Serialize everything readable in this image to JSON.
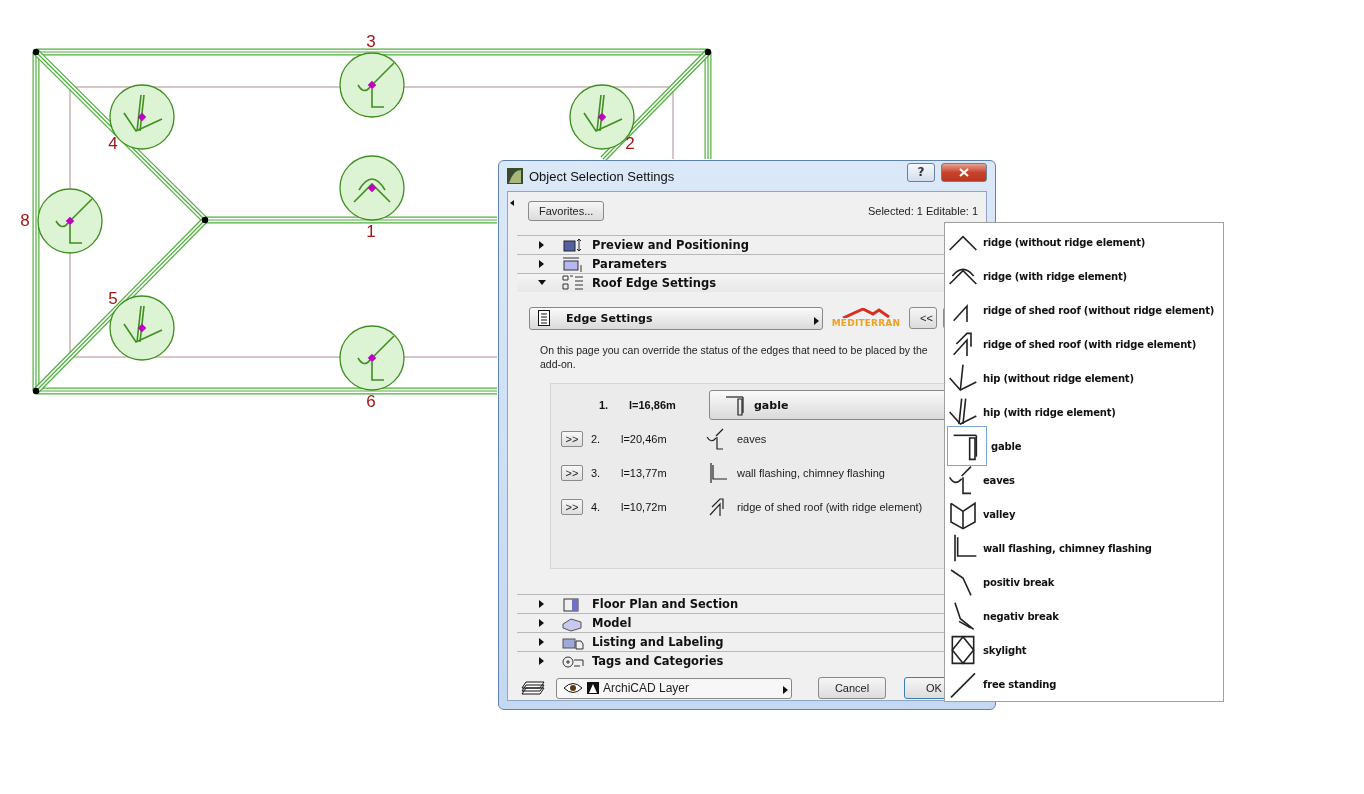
{
  "canvas": {
    "markers": [
      {
        "label": "3",
        "kind": "eaves"
      },
      {
        "label": "4",
        "kind": "hip"
      },
      {
        "label": "2",
        "kind": "hip"
      },
      {
        "label": "8",
        "kind": "eaves"
      },
      {
        "label": "1",
        "kind": "ridge_element"
      },
      {
        "label": "5",
        "kind": "hip"
      },
      {
        "label": "6",
        "kind": "eaves"
      }
    ]
  },
  "dialog": {
    "title": "Object Selection Settings",
    "help": "?",
    "favorites": "Favorites...",
    "status": "Selected: 1 Editable: 1",
    "sections_top": [
      {
        "title": "Preview and Positioning",
        "kind": "preview",
        "expanded": false
      },
      {
        "title": "Parameters",
        "kind": "parameters",
        "expanded": false
      },
      {
        "title": "Roof Edge Settings",
        "kind": "roof_edge",
        "expanded": true
      }
    ],
    "page_selector": "Edge Settings",
    "logo": "MEDITERRAN",
    "prev_button": "<<",
    "description": "On this page you can override the status of the edges that need to be placed by the add-on.",
    "edges": [
      {
        "number": "1.",
        "length": "l=16,86m",
        "kind": "gable",
        "label": "gable",
        "selected": true
      },
      {
        "button": ">>",
        "number": "2.",
        "length": "l=20,46m",
        "kind": "eaves",
        "label": "eaves",
        "selected": false
      },
      {
        "button": ">>",
        "number": "3.",
        "length": "l=13,77m",
        "kind": "wall_flashing",
        "label": "wall flashing, chimney flashing",
        "selected": false
      },
      {
        "button": ">>",
        "number": "4.",
        "length": "l=10,72m",
        "kind": "shed_element",
        "label": "ridge of shed roof (with ridge element)",
        "selected": false
      }
    ],
    "sections_bottom": [
      {
        "title": "Floor Plan and Section",
        "kind": "floor_plan",
        "expanded": false
      },
      {
        "title": "Model",
        "kind": "model",
        "expanded": false
      },
      {
        "title": "Listing and Labeling",
        "kind": "listing",
        "expanded": false
      },
      {
        "title": "Tags and Categories",
        "kind": "tags",
        "expanded": false
      }
    ],
    "layer": "ArchiCAD Layer",
    "cancel": "Cancel",
    "ok": "OK"
  },
  "menu": {
    "items": [
      {
        "label": "ridge (without ridge element)",
        "kind": "ridge",
        "selected": false
      },
      {
        "label": "ridge (with ridge element)",
        "kind": "ridge_element",
        "selected": false
      },
      {
        "label": "ridge of shed roof (without ridge element)",
        "kind": "shed",
        "selected": false
      },
      {
        "label": "ridge of shed roof (with ridge element)",
        "kind": "shed_element",
        "selected": false
      },
      {
        "label": "hip (without ridge element)",
        "kind": "hip",
        "selected": false
      },
      {
        "label": "hip (with ridge element)",
        "kind": "hip_element",
        "selected": false
      },
      {
        "label": "gable",
        "kind": "gable",
        "selected": true
      },
      {
        "label": "eaves",
        "kind": "eaves",
        "selected": false
      },
      {
        "label": "valley",
        "kind": "valley",
        "selected": false
      },
      {
        "label": "wall flashing, chimney flashing",
        "kind": "wall_flashing",
        "selected": false
      },
      {
        "label": "positiv break",
        "kind": "positive_break",
        "selected": false
      },
      {
        "label": "negativ break",
        "kind": "negative_break",
        "selected": false
      },
      {
        "label": "skylight",
        "kind": "skylight",
        "selected": false
      },
      {
        "label": "free standing",
        "kind": "free_standing",
        "selected": false
      }
    ]
  }
}
